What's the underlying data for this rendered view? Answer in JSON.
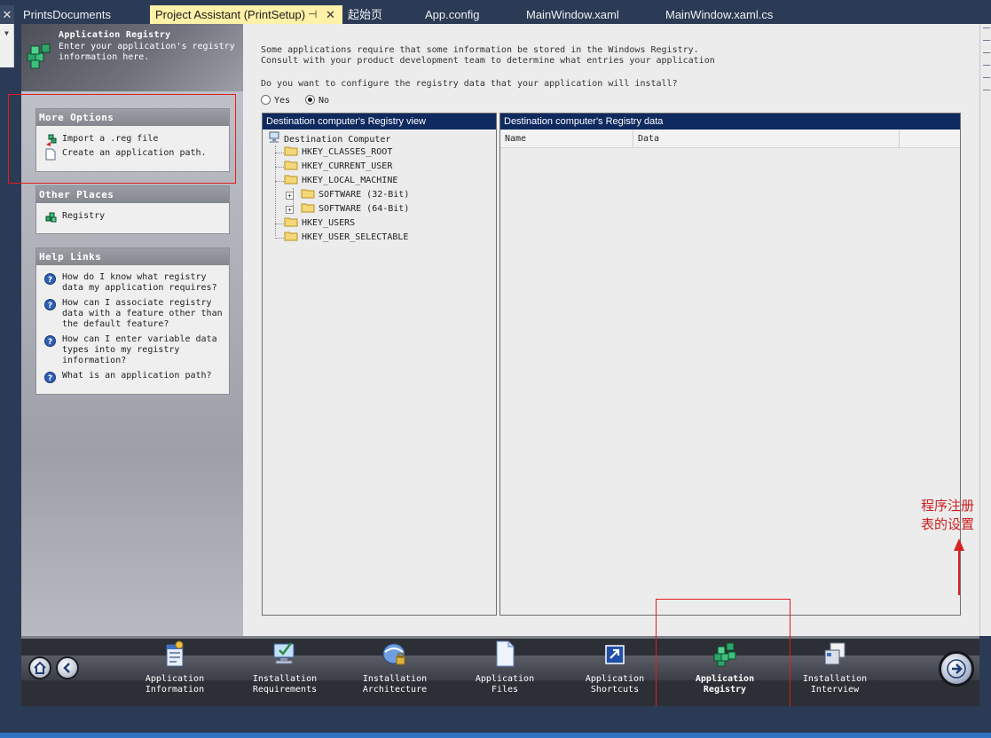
{
  "tabs": [
    {
      "label": "PrintsDocuments",
      "active": false
    },
    {
      "label": "Project Assistant (PrintSetup)",
      "active": true
    },
    {
      "label": "起始页",
      "active": false
    },
    {
      "label": "App.config",
      "active": false
    },
    {
      "label": "MainWindow.xaml",
      "active": false
    },
    {
      "label": "MainWindow.xaml.cs",
      "active": false
    }
  ],
  "tab_glyphs": {
    "close": "✕",
    "pin": "⊣",
    "left_close": "✕"
  },
  "header": {
    "title": "Application Registry",
    "description": "Enter your application's registry information here."
  },
  "more_options": {
    "title": "More Options",
    "items": [
      "Import a .reg file",
      "Create an application path."
    ]
  },
  "other_places": {
    "title": "Other Places",
    "items": [
      "Registry"
    ]
  },
  "help_links": {
    "title": "Help Links",
    "items": [
      "How do I know what registry data my application requires?",
      "How can I associate registry data with a feature other than the default feature?",
      "How can I enter variable data types into my registry information?",
      "What is an application path?"
    ]
  },
  "main": {
    "intro_line1": "Some applications require that some information be stored in the Windows Registry.",
    "intro_line2": "Consult with your product development team to determine what entries your application",
    "question": "Do you want to configure the registry data that your application will install?",
    "yes_label": "Yes",
    "no_label": "No",
    "selected": "No"
  },
  "registry_view": {
    "title": "Destination computer's Registry view",
    "root": "Destination Computer",
    "keys": [
      "HKEY_CLASSES_ROOT",
      "HKEY_CURRENT_USER",
      "HKEY_LOCAL_MACHINE",
      "HKEY_USERS",
      "HKEY_USER_SELECTABLE"
    ],
    "subkeys": [
      "SOFTWARE (32-Bit)",
      "SOFTWARE (64-Bit)"
    ]
  },
  "registry_data": {
    "title": "Destination computer's Registry data",
    "columns": [
      "Name",
      "Data"
    ]
  },
  "annotation": "程序注册表的设置",
  "steps": [
    {
      "line1": "Application",
      "line2": "Information",
      "icon": "app-info-icon"
    },
    {
      "line1": "Installation",
      "line2": "Requirements",
      "icon": "computer-check-icon"
    },
    {
      "line1": "Installation",
      "line2": "Architecture",
      "icon": "architecture-icon"
    },
    {
      "line1": "Application",
      "line2": "Files",
      "icon": "file-icon"
    },
    {
      "line1": "Application",
      "line2": "Shortcuts",
      "icon": "shortcut-icon"
    },
    {
      "line1": "Application",
      "line2": "Registry",
      "icon": "registry-icon",
      "current": true
    },
    {
      "line1": "Installation",
      "line2": "Interview",
      "icon": "interview-icon"
    }
  ],
  "colors": {
    "pane_header": "#0f2a5f",
    "active_tab": "#fff1a8",
    "annotation": "#cc1f1f"
  }
}
